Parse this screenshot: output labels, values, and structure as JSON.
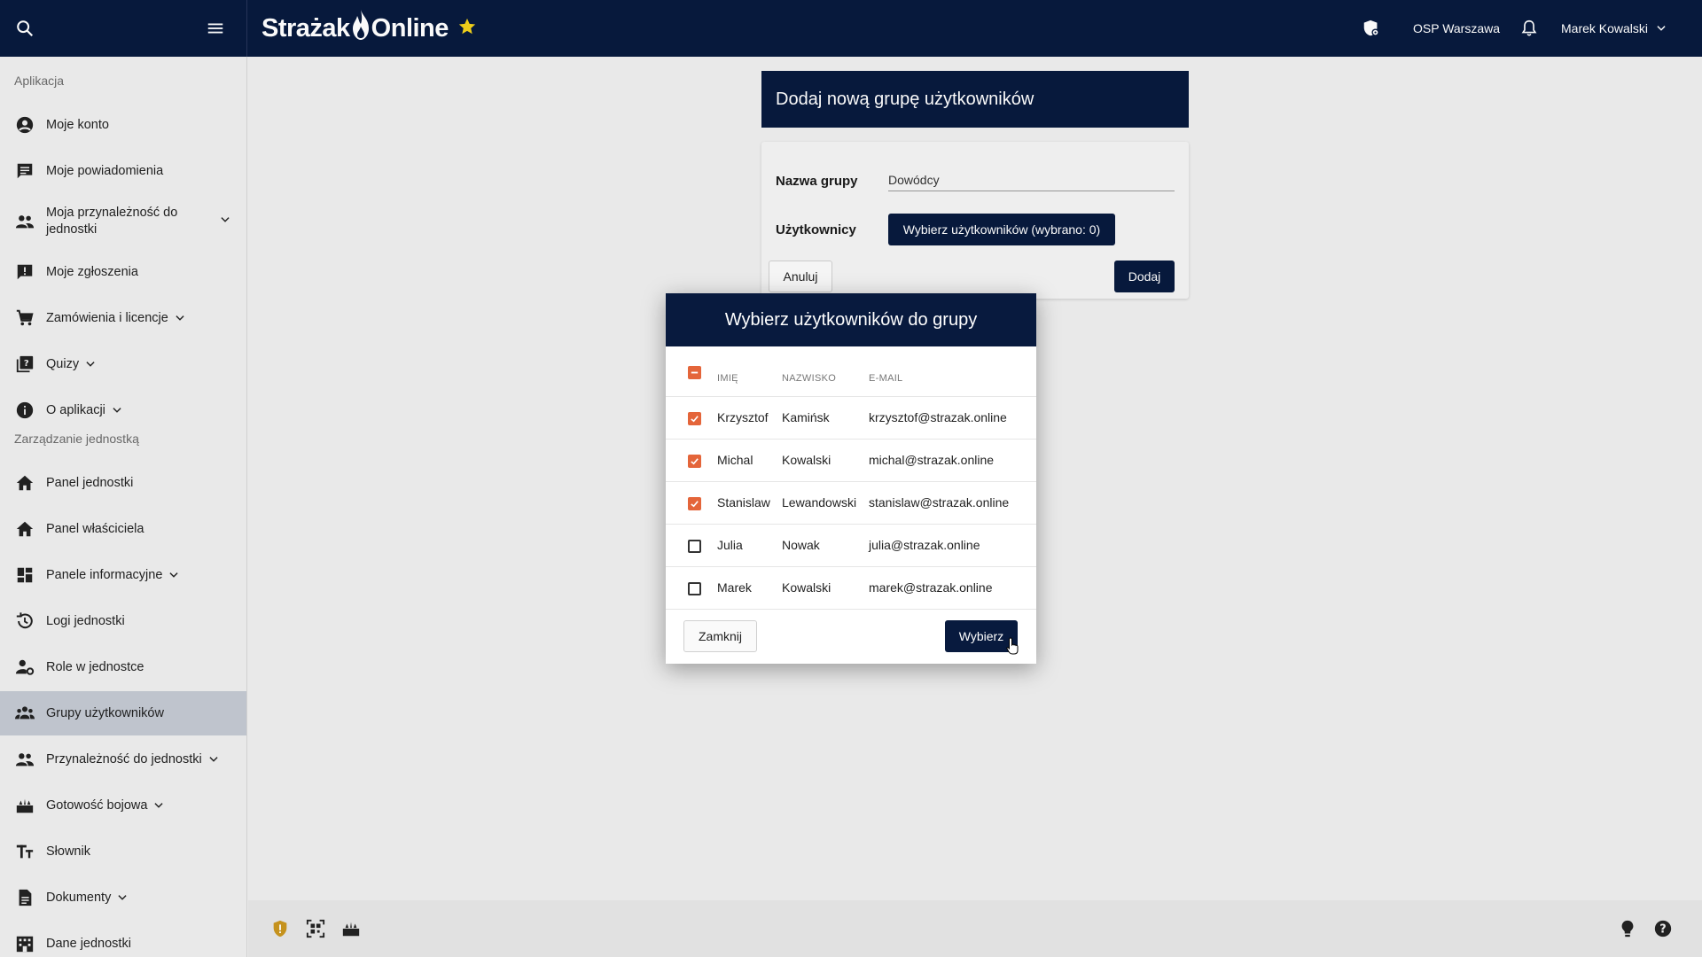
{
  "topbar": {
    "logo_part1": "Strażak",
    "logo_part2": "Online",
    "unit_name": "OSP Warszawa",
    "user_name": "Marek Kowalski"
  },
  "sidebar": {
    "section_app": "Aplikacja",
    "section_unit": "Zarządzanie jednostką",
    "items": [
      {
        "label": "Moje konto",
        "icon": "account-circle-icon"
      },
      {
        "label": "Moje powiadomienia",
        "icon": "chat-icon"
      },
      {
        "label": "Moja przynależność do jednostki",
        "icon": "people-icon"
      },
      {
        "label": "Moje zgłoszenia",
        "icon": "report-icon"
      },
      {
        "label": "Zamówienia i licencje",
        "icon": "cart-icon"
      },
      {
        "label": "Quizy",
        "icon": "quiz-icon"
      },
      {
        "label": "O aplikacji",
        "icon": "info-icon"
      },
      {
        "label": "Panel jednostki",
        "icon": "home-icon"
      },
      {
        "label": "Panel właściciela",
        "icon": "home-icon"
      },
      {
        "label": "Panele informacyjne",
        "icon": "dashboard-icon"
      },
      {
        "label": "Logi jednostki",
        "icon": "history-icon"
      },
      {
        "label": "Role w jednostce",
        "icon": "person-gear-icon"
      },
      {
        "label": "Grupy użytkowników",
        "icon": "groups-icon"
      },
      {
        "label": "Przynależność do jednostki",
        "icon": "people-icon"
      },
      {
        "label": "Gotowość bojowa",
        "icon": "fire-truck-icon"
      },
      {
        "label": "Słownik",
        "icon": "text-fields-icon"
      },
      {
        "label": "Dokumenty",
        "icon": "document-icon"
      },
      {
        "label": "Dane jednostki",
        "icon": "building-icon"
      }
    ]
  },
  "form": {
    "title": "Dodaj nową grupę użytkowników",
    "name_label": "Nazwa grupy",
    "name_value": "Dowódcy",
    "users_label": "Użytkownicy",
    "select_users_button": "Wybierz użytkowników (wybrano: 0)",
    "cancel_button": "Anuluj",
    "add_button": "Dodaj"
  },
  "modal": {
    "title": "Wybierz użytkowników do grupy",
    "columns": [
      "IMIĘ",
      "NAZWISKO",
      "E-MAIL"
    ],
    "rows": [
      {
        "first": "Krzysztof",
        "last": "Kamińsk",
        "email": "krzysztof@strazak.online",
        "checked": true
      },
      {
        "first": "Michal",
        "last": "Kowalski",
        "email": "michal@strazak.online",
        "checked": true
      },
      {
        "first": "Stanislaw",
        "last": "Lewandowski",
        "email": "stanislaw@strazak.online",
        "checked": true
      },
      {
        "first": "Julia",
        "last": "Nowak",
        "email": "julia@strazak.online",
        "checked": false
      },
      {
        "first": "Marek",
        "last": "Kowalski",
        "email": "marek@strazak.online",
        "checked": false
      }
    ],
    "close_button": "Zamknij",
    "select_button": "Wybierz"
  },
  "colors": {
    "navy": "#081a3e",
    "accent_orange": "#e4653a",
    "star_yellow": "#f2d21b",
    "active_item": "#c3c8d2"
  }
}
